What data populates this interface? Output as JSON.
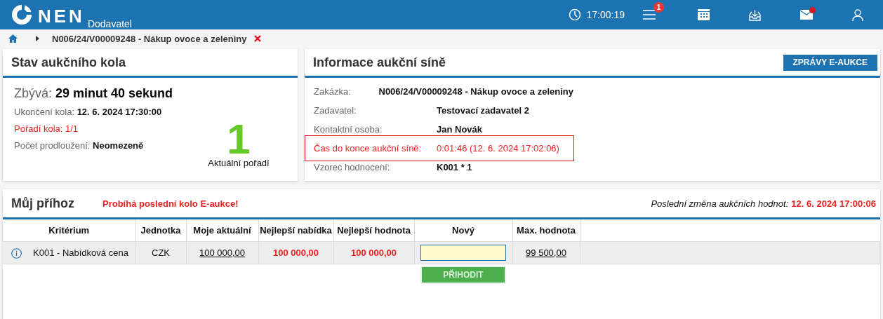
{
  "header": {
    "logo": "NEN",
    "subtitle": "Dodavatel",
    "time": "17:00:19",
    "notification_count": "1",
    "mail_unread": true
  },
  "breadcrumb": {
    "title": "N006/24/V00009248 - Nákup ovoce a zeleniny"
  },
  "round_status": {
    "title": "Stav aukčního kola",
    "remaining_label": "Zbývá:",
    "remaining_value": "29 minut 40 sekund",
    "fields": [
      {
        "label": "Ukončení kola:",
        "value": "12. 6. 2024 17:30:00",
        "highlight": false
      },
      {
        "label": "Pořadí kola:",
        "value": "1/1",
        "highlight": true
      },
      {
        "label": "Počet prodloužení:",
        "value": "Neomezeně",
        "highlight": false
      }
    ],
    "rank": "1",
    "rank_label": "Aktuální pořadí"
  },
  "auction_info": {
    "title": "Informace aukční síně",
    "button": "ZPRÁVY E-AUKCE",
    "fields": [
      {
        "label": "Zakázka:",
        "value": "N006/24/V00009248 - Nákup ovoce a zeleniny",
        "highlight": false
      },
      {
        "label": "Zadavatel:",
        "value": "Testovací zadavatel 2",
        "highlight": false
      },
      {
        "label": "Kontaktní osoba:",
        "value": "Jan Novák",
        "highlight": false
      },
      {
        "label": "Čas do konce aukční síně:",
        "value": "0:01:46 (12. 6. 2024 17:02:06)",
        "highlight": true
      },
      {
        "label": "Vzorec hodnocení:",
        "value": "K001 * 1",
        "highlight": false
      }
    ]
  },
  "bid": {
    "title": "Můj příhoz",
    "notice": "Probíhá poslední kolo E-aukce!",
    "last_change_label": "Poslední změna aukčních hodnot:",
    "last_change_value": "12. 6. 2024 17:00:06",
    "columns": [
      "Kritérium",
      "Jednotka",
      "Moje aktuální",
      "Nejlepší nabídka",
      "Nejlepší hodnota",
      "Nový",
      "Max. hodnota"
    ],
    "rows": [
      {
        "criterion": "K001 - Nabídková cena",
        "unit": "CZK",
        "my_current": "100 000,00",
        "best_offer": "100 000,00",
        "best_value": "100 000,00",
        "max_value": "99 500,00"
      }
    ],
    "bid_button": "PŘIHODIT"
  }
}
